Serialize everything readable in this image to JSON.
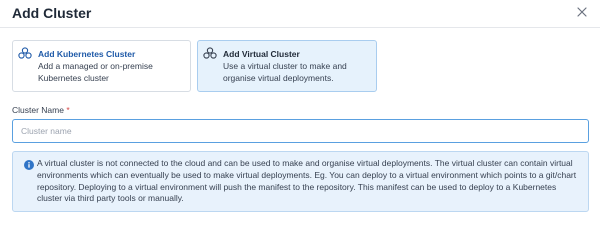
{
  "dialog": {
    "title": "Add Cluster"
  },
  "options": [
    {
      "title": "Add Kubernetes Cluster",
      "description": "Add a managed or on-premise Kubernetes cluster",
      "selected": false
    },
    {
      "title": "Add Virtual Cluster",
      "description": "Use a virtual cluster to make and organise virtual deployments.",
      "selected": true
    }
  ],
  "form": {
    "cluster_name_label": "Cluster Name",
    "required_marker": "*",
    "cluster_name_value": "",
    "cluster_name_placeholder": "Cluster name"
  },
  "info": {
    "text": "A virtual cluster is not connected to the cloud and can be used to make and organise virtual deployments. The virtual cluster can contain virtual environments which can eventually be used to make virtual deployments. Eg. You can deploy to a virtual environment which points to a git/chart repository. Deploying to a virtual environment will push the manifest to the repository. This manifest can be used to deploy to a Kubernetes cluster via third party tools or manually."
  },
  "colors": {
    "accent": "#1f5aa8",
    "selected_bg": "#e6f2fc",
    "info_bg": "#e8f2fc",
    "input_border_focus": "#5aa0e0",
    "required": "#d64545"
  },
  "icons": {
    "close": "close-icon",
    "kubernetes": "cluster-icon",
    "virtual": "cluster-icon",
    "info": "info-icon"
  }
}
